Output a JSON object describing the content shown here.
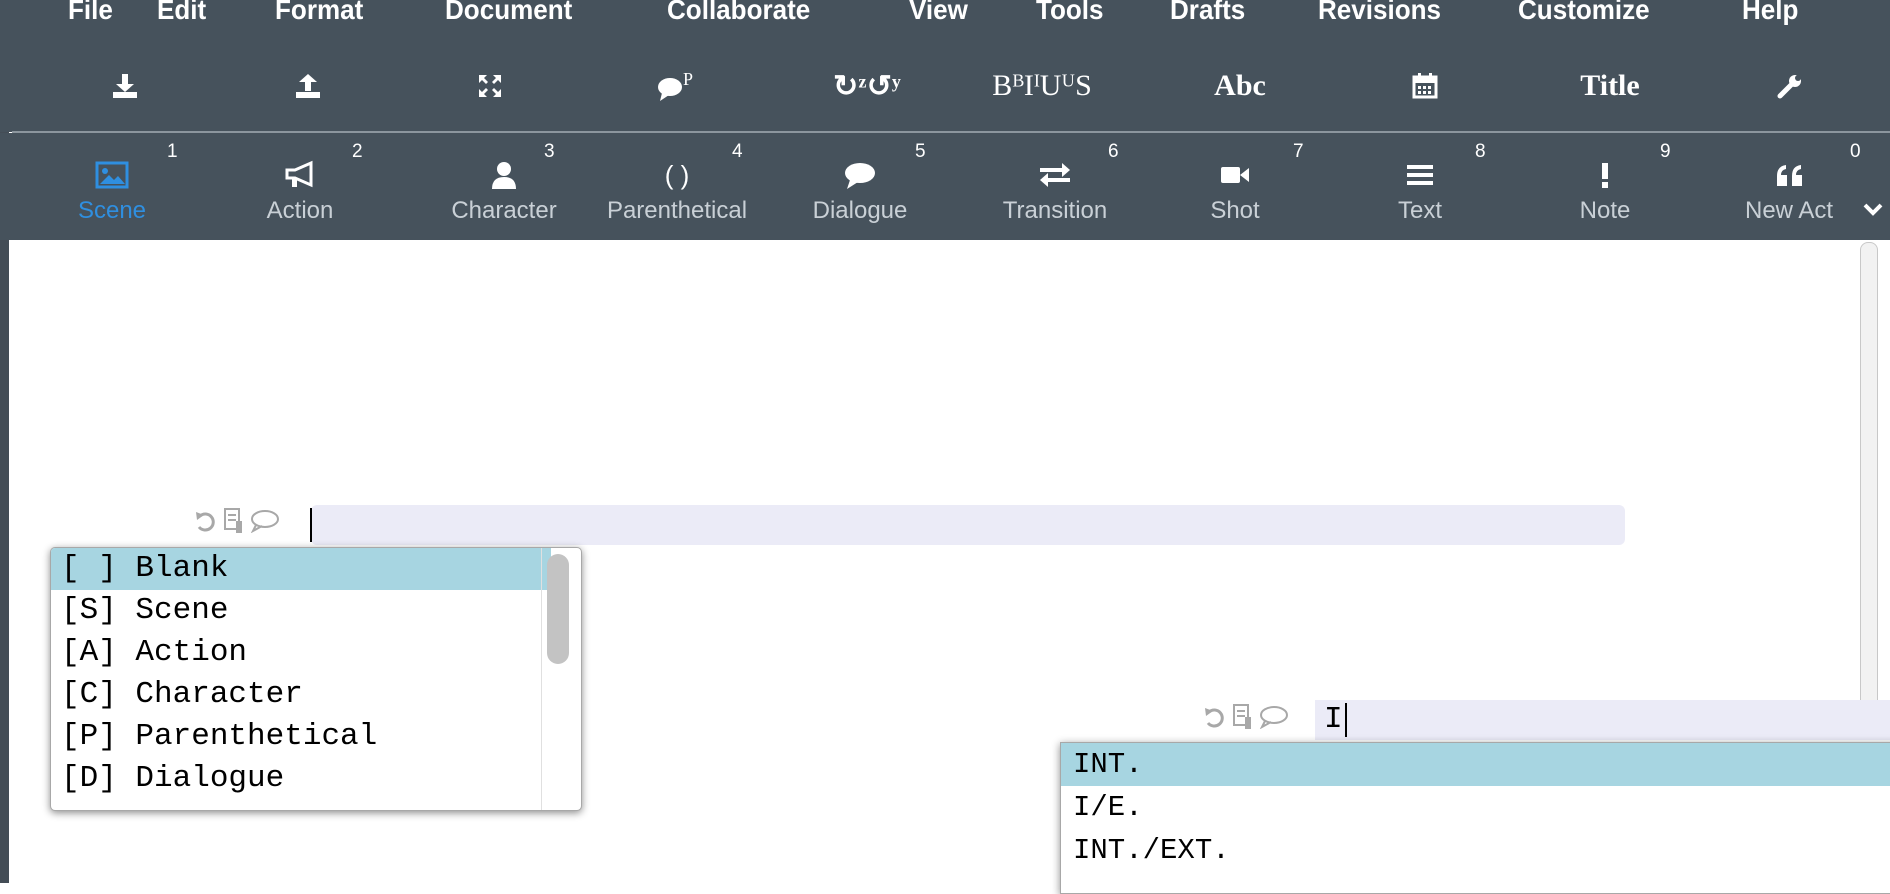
{
  "menu": {
    "items": [
      "File",
      "Edit",
      "Format",
      "Document",
      "Collaborate",
      "View",
      "Tools",
      "Drafts",
      "Revisions",
      "Customize",
      "Help"
    ]
  },
  "toolbar": {
    "buttons": [
      {
        "icon": "download-icon"
      },
      {
        "icon": "upload-icon"
      },
      {
        "icon": "fullscreen-icon"
      },
      {
        "icon": "comment-pin-icon"
      },
      {
        "icon": "undo-redo-icon",
        "text": "↻ᶻ↺ʸ"
      },
      {
        "icon": "text-style-icon",
        "text": "BᴮIᴵUᵁS"
      },
      {
        "icon": "spellcheck-icon",
        "text": "Abc"
      },
      {
        "icon": "calendar-icon"
      },
      {
        "icon": "title-page-icon",
        "text": "Title"
      },
      {
        "icon": "wrench-icon"
      }
    ]
  },
  "elements": {
    "items": [
      {
        "label": "Scene",
        "num": "1",
        "icon": "image-icon",
        "active": true
      },
      {
        "label": "Action",
        "num": "2",
        "icon": "megaphone-icon"
      },
      {
        "label": "Character",
        "num": "3",
        "icon": "user-icon"
      },
      {
        "label": "Parenthetical",
        "num": "4",
        "icon": "parentheses-icon",
        "icon_text": "( )"
      },
      {
        "label": "Dialogue",
        "num": "5",
        "icon": "speech-bubble-icon"
      },
      {
        "label": "Transition",
        "num": "6",
        "icon": "transfer-arrows-icon"
      },
      {
        "label": "Shot",
        "num": "7",
        "icon": "video-camera-icon"
      },
      {
        "label": "Text",
        "num": "8",
        "icon": "lines-icon"
      },
      {
        "label": "Note",
        "num": "9",
        "icon": "exclamation-icon"
      },
      {
        "label": "New Act",
        "num": "0",
        "icon": "quote-icon"
      }
    ],
    "active_color": "#2f8fe0"
  },
  "editor": {
    "element_popup": {
      "items": [
        "[ ] Blank",
        "[S] Scene",
        "[A] Action",
        "[C] Character",
        "[P] Parenthetical",
        "[D] Dialogue"
      ],
      "selected_index": 0
    },
    "scene_line": {
      "value": "I"
    },
    "scene_popup": {
      "items": [
        "INT.",
        "I/E.",
        "INT./EXT."
      ],
      "selected_index": 0
    }
  },
  "colors": {
    "toolbar_bg": "#46525c",
    "selection": "#a7d5e1",
    "line_highlight": "#ebebf7"
  }
}
